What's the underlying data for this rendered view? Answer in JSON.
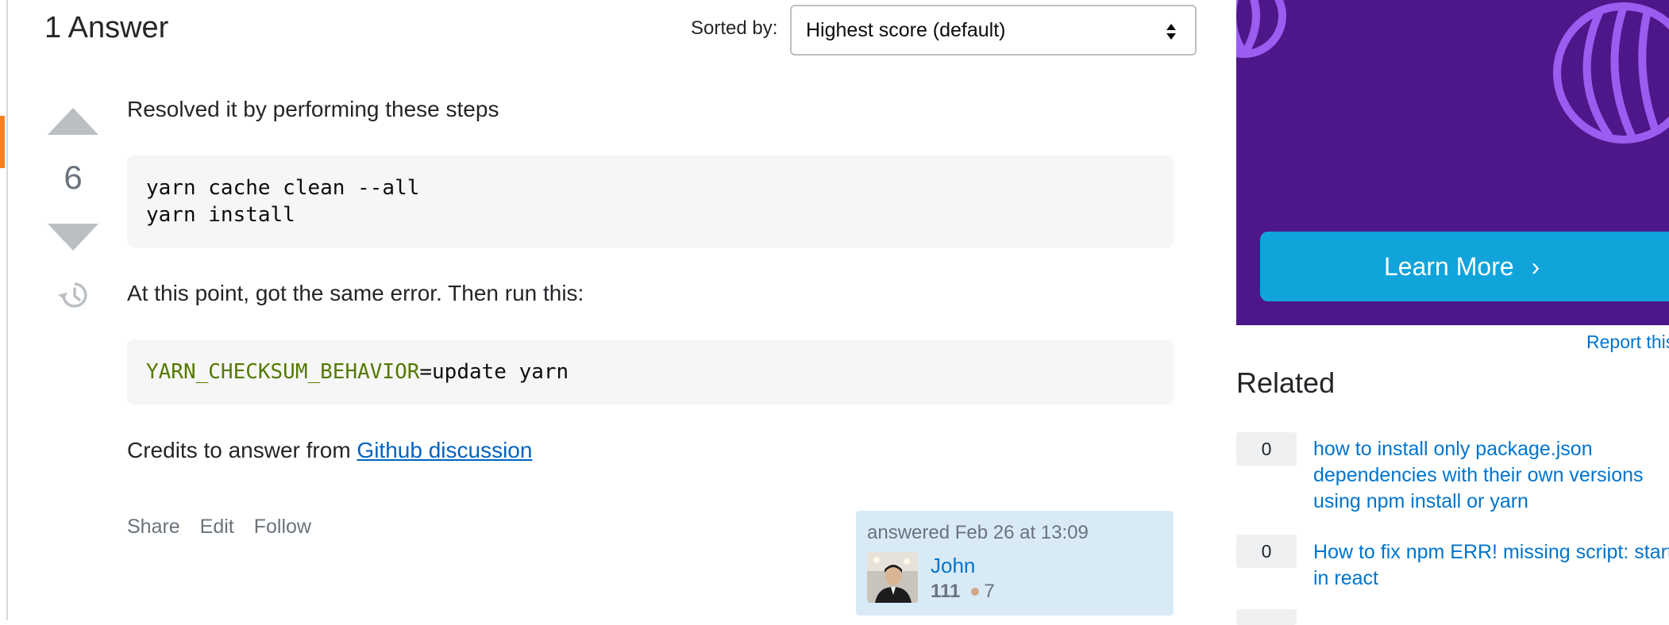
{
  "answers_header": {
    "count_label": "1 Answer",
    "sort_label": "Sorted by:",
    "sort_value": "Highest score (default)"
  },
  "answer": {
    "score": "6",
    "intro": "Resolved it by performing these steps",
    "code_block_1": [
      "yarn cache clean --all",
      "yarn install"
    ],
    "middle": "At this point, got the same error. Then run this:",
    "code_block_2": {
      "env_var": "YARN_CHECKSUM_BEHAVIOR",
      "rest": "=update yarn"
    },
    "credits_prefix": "Credits to answer from ",
    "credits_link": "Github discussion",
    "menu": {
      "share": "Share",
      "edit": "Edit",
      "follow": "Follow"
    },
    "user_card": {
      "action": "answered Feb 26 at 13:09",
      "name": "John",
      "reputation": "111",
      "bronze": "7"
    }
  },
  "sidebar": {
    "ad_button": "Learn More",
    "report_link": "Report this ad",
    "related_title": "Related",
    "related": [
      {
        "score": "0",
        "lines": [
          "how to install only package.json",
          "dependencies with their own versions",
          "using npm install or yarn"
        ]
      },
      {
        "score": "0",
        "lines": [
          "How to fix npm ERR! missing script: start",
          "in react"
        ]
      }
    ]
  },
  "colors": {
    "accent": "#f48024",
    "link": "#0074cc",
    "ad_bg": "#4d178a",
    "ad_button": "#10a4db",
    "user_card_bg": "#d9eaf7"
  }
}
